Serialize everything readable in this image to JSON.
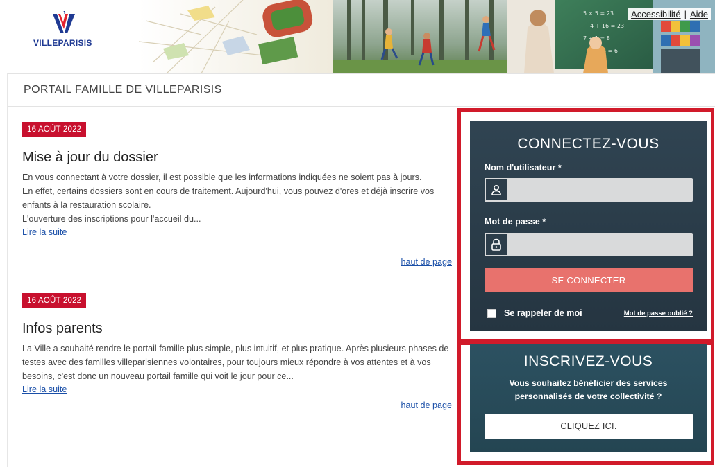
{
  "header": {
    "logo_text": "VILLEPARISIS",
    "links": {
      "accessibility": "Accessibilité",
      "separator": "|",
      "help": "Aide"
    }
  },
  "portal_title": "PORTAIL FAMILLE DE VILLEPARISIS",
  "news": [
    {
      "date": "16 AOÛT 2022",
      "title": "Mise à jour du dossier",
      "paragraphs": [
        "En vous connectant à votre dossier, il est possible que les informations indiquées ne soient pas à jours.",
        "En effet, certains dossiers sont en cours de traitement. Aujourd'hui, vous pouvez d'ores et déjà inscrire vos enfants à la restauration scolaire.",
        "L'ouverture des inscriptions pour l'accueil du..."
      ],
      "read_more": "Lire la suite",
      "top_of_page": "haut de page"
    },
    {
      "date": "16 AOÛT 2022",
      "title": "Infos parents",
      "paragraphs": [
        "La Ville a souhaité rendre le portail famille plus simple, plus intuitif, et plus pratique. Après plusieurs phases de testes avec des familles villeparisiennes volontaires, pour toujours mieux répondre à vos attentes et à vos besoins, c'est donc un nouveau portail famille qui voit le jour pour ce..."
      ],
      "read_more": "Lire la suite",
      "top_of_page": "haut de page"
    }
  ],
  "login": {
    "title": "CONNECTEZ-VOUS",
    "username_label": "Nom d'utilisateur *",
    "username_value": "",
    "password_label": "Mot de passe *",
    "password_value": "",
    "submit": "SE CONNECTER",
    "remember": "Se rappeler de moi",
    "forgot": "Mot de passe oublié ?"
  },
  "signup": {
    "title": "INSCRIVEZ-VOUS",
    "description": "Vous souhaitez bénéficier des services personnalisés de votre collectivité ?",
    "button": "CLIQUEZ ICI."
  },
  "colors": {
    "badge_red": "#c8102e",
    "highlight_frame": "#d11a2a",
    "login_panel": "#2b3d4a",
    "signup_panel": "#2a4d5c",
    "connect_button": "#e8726d",
    "link_blue": "#1a4fa8"
  },
  "icons": {
    "username_field": "user-icon",
    "password_field": "lock-icon"
  }
}
